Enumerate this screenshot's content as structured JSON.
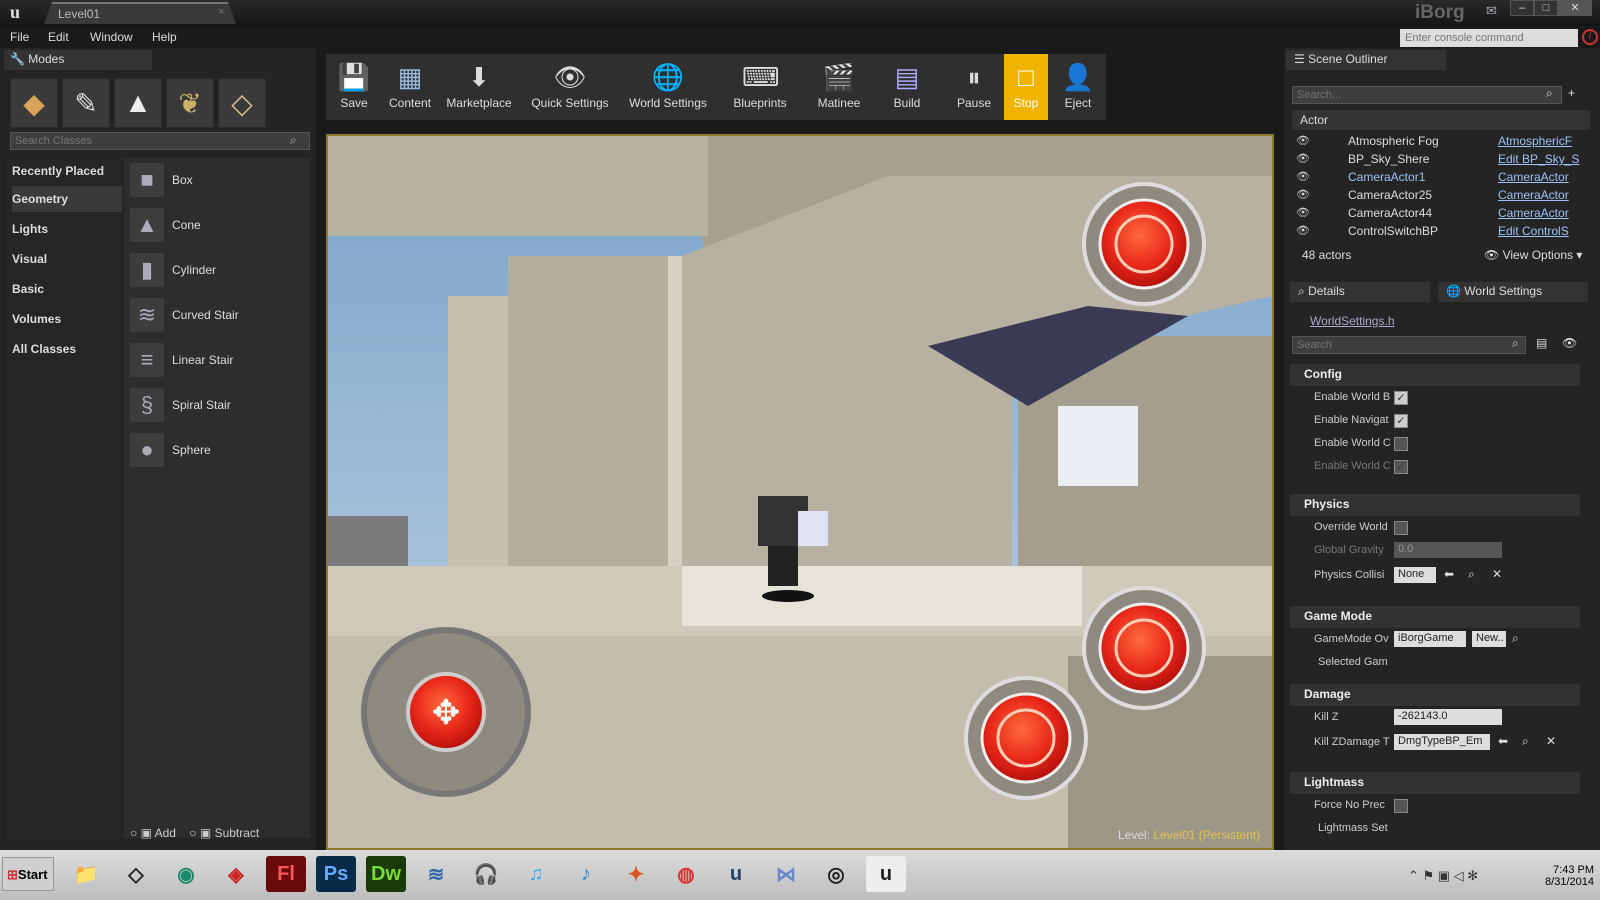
{
  "window": {
    "tab_title": "Level01",
    "app_name": "iBorg"
  },
  "menu": [
    "File",
    "Edit",
    "Window",
    "Help"
  ],
  "console_placeholder": "Enter console command",
  "modes": {
    "tab": "Modes",
    "search_placeholder": "Search Classes",
    "categories": [
      "Recently Placed",
      "Geometry",
      "Lights",
      "Visual",
      "Basic",
      "Volumes",
      "All Classes"
    ],
    "selected_category": "Geometry",
    "items": [
      "Box",
      "Cone",
      "Cylinder",
      "Curved Stair",
      "Linear Stair",
      "Spiral Stair",
      "Sphere"
    ],
    "add_label": "Add",
    "subtract_label": "Subtract"
  },
  "toolbar": [
    "Save",
    "Content",
    "Marketplace",
    "Quick Settings",
    "World Settings",
    "Blueprints",
    "Matinee",
    "Build",
    "Pause",
    "Stop",
    "Eject"
  ],
  "viewport": {
    "level_label": "Level:",
    "level_name": "Level01 (Persistent)"
  },
  "outliner": {
    "tab": "Scene Outliner",
    "search_placeholder": "Search...",
    "column": "Actor",
    "rows": [
      {
        "name": "Atmospheric Fog",
        "type": "AtmosphericF"
      },
      {
        "name": "BP_Sky_Shere",
        "type": "Edit BP_Sky_S"
      },
      {
        "name": "CameraActor1",
        "type": "CameraActor"
      },
      {
        "name": "CameraActor25",
        "type": "CameraActor"
      },
      {
        "name": "CameraActor44",
        "type": "CameraActor"
      },
      {
        "name": "ControlSwitchBP",
        "type": "Edit ControlS"
      }
    ],
    "count": "48 actors",
    "view_options": "View Options"
  },
  "details": {
    "tab_details": "Details",
    "tab_world": "World Settings",
    "file_link": "WorldSettings.h",
    "search_placeholder": "Search",
    "sections": {
      "config": "Config",
      "physics": "Physics",
      "game_mode": "Game Mode",
      "damage": "Damage",
      "lightmass": "Lightmass"
    },
    "props": {
      "enable_world_b": "Enable World B",
      "enable_navigat": "Enable Navigat",
      "enable_world_c1": "Enable World C",
      "enable_world_c2": "Enable World C",
      "override_world": "Override World",
      "global_gravity": "Global Gravity",
      "global_gravity_val": "0.0",
      "physics_collis": "Physics Collisi",
      "physics_collis_val": "None",
      "gamemode_ov": "GameMode Ov",
      "gamemode_val": "iBorgGame",
      "new_btn": "New..",
      "selected_gam": "Selected Gam",
      "kill_z": "Kill Z",
      "kill_z_val": "-262143.0",
      "kill_zdamage": "Kill ZDamage T",
      "kill_zdamage_val": "DmgTypeBP_Em",
      "force_no_prec": "Force No Prec",
      "lightmass_set": "Lightmass Set"
    }
  },
  "taskbar": {
    "start": "Start",
    "time": "7:43 PM",
    "date": "8/31/2014"
  }
}
